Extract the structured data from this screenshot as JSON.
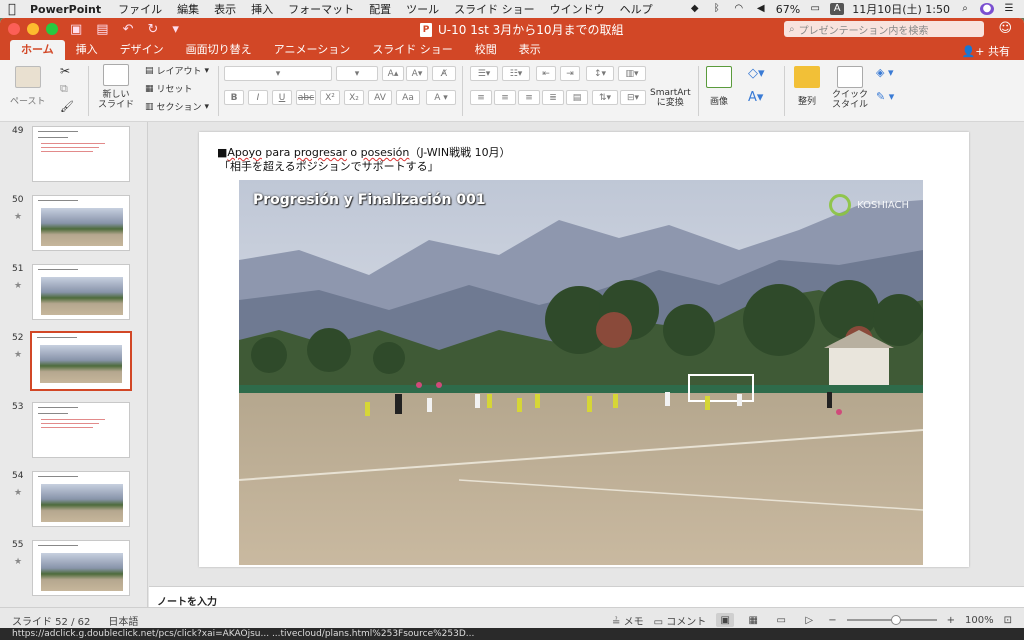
{
  "menubar": {
    "app": "PowerPoint",
    "items": [
      "ファイル",
      "編集",
      "表示",
      "挿入",
      "フォーマット",
      "配置",
      "ツール",
      "スライド ショー",
      "ウインドウ",
      "ヘルプ"
    ],
    "battery": "67%",
    "datetime": "11月10日(土)  1:50"
  },
  "window": {
    "title": "U-10 1st 3月から10月までの取組",
    "search_placeholder": "プレゼンテーション内を検索",
    "share_label": "共有"
  },
  "tabs": [
    "ホーム",
    "挿入",
    "デザイン",
    "画面切り替え",
    "アニメーション",
    "スライド ショー",
    "校閲",
    "表示"
  ],
  "active_tab": "ホーム",
  "ribbon": {
    "paste": "ペースト",
    "new_slide": "新しい\nスライド",
    "layout": "レイアウト",
    "reset": "リセット",
    "section": "セクション",
    "smartart": "SmartArt\nに変換",
    "picture": "画像",
    "arrange": "整列",
    "quick_style": "クイック\nスタイル"
  },
  "thumbnails": [
    {
      "num": "49",
      "type": "text",
      "star": false
    },
    {
      "num": "50",
      "type": "photo",
      "star": true
    },
    {
      "num": "51",
      "type": "photo",
      "star": true
    },
    {
      "num": "52",
      "type": "photo",
      "star": true,
      "selected": true
    },
    {
      "num": "53",
      "type": "text",
      "star": false
    },
    {
      "num": "54",
      "type": "photo",
      "star": true
    },
    {
      "num": "55",
      "type": "photo",
      "star": true
    }
  ],
  "slide": {
    "title_prefix": "■",
    "title_word1": "Apoyo",
    "title_mid1": " para ",
    "title_word2": "progresar",
    "title_mid2": " o ",
    "title_word3": "posesión",
    "title_suffix": "（J-WIN戦戦  10月）",
    "subtitle": "「相手を超えるポジションでサポートする」",
    "video_caption": "Progresión y Finalización 001",
    "brand": "KOSHIACH"
  },
  "notes_placeholder": "ノートを入力",
  "status": {
    "slide_counter": "スライド 52 / 62",
    "language": "日本語",
    "notes_label": "メモ",
    "comments_label": "コメント",
    "zoom": "100%",
    "zoom_fraction": 0.55
  },
  "url_text": "https://adclick.g.doubleclick.net/pcs/click?xai=AKAOjsu... ...tivecloud/plans.html%253Fsource%253D...",
  "colors": {
    "accent": "#d24726",
    "ribbon_bg": "#f3f3f3"
  }
}
